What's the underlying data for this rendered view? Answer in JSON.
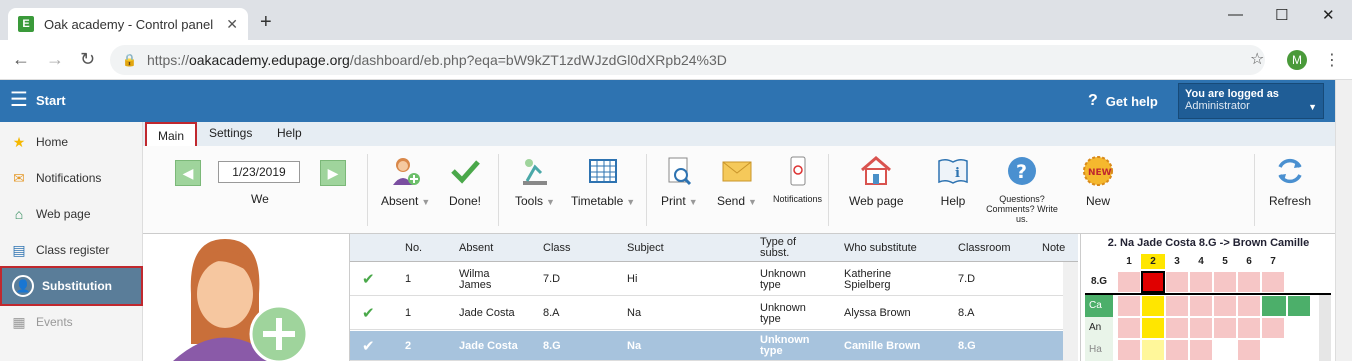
{
  "browser": {
    "tab_title": "Oak academy - Control panel",
    "favicon_letter": "E",
    "url_host": "oakacademy.edupage.org",
    "url_path": "/dashboard/eb.php?eqa=bW9kZT1zdWJzdGl0dXRpb24%3D",
    "url_scheme": "https://",
    "profile_initial": "M"
  },
  "header": {
    "start_label": "Start",
    "get_help": "Get help",
    "logged_line1": "You are logged as",
    "logged_line2": "Administrator"
  },
  "sidebar": {
    "items": [
      {
        "label": "Home",
        "icon": "star-icon"
      },
      {
        "label": "Notifications",
        "icon": "envelope-icon"
      },
      {
        "label": "Web page",
        "icon": "house-icon"
      },
      {
        "label": "Class register",
        "icon": "book-icon"
      },
      {
        "label": "Substitution",
        "icon": "person-icon"
      },
      {
        "label": "Events",
        "icon": "calendar-icon"
      }
    ]
  },
  "ribbon": {
    "tabs": [
      "Main",
      "Settings",
      "Help"
    ],
    "date": "1/23/2019",
    "weekday": "We",
    "buttons": {
      "absent": "Absent",
      "done": "Done!",
      "tools": "Tools",
      "timetable": "Timetable",
      "print": "Print",
      "send": "Send",
      "notifications": "Notifications",
      "webpage": "Web page",
      "help": "Help",
      "questions": "Questions? Comments? Write us.",
      "new": "New",
      "refresh": "Refresh"
    }
  },
  "table": {
    "headers": [
      "No.",
      "Absent",
      "Class",
      "Subject",
      "Type of subst.",
      "Who substitute",
      "Classroom",
      "Note"
    ],
    "rows": [
      {
        "no": "1",
        "absent": "Wilma James",
        "class": "7.D",
        "subject": "Hi",
        "type": "Unknown type",
        "who": "Katherine Spielberg",
        "room": "7.D",
        "note": ""
      },
      {
        "no": "1",
        "absent": "Jade Costa",
        "class": "8.A",
        "subject": "Na",
        "type": "Unknown type",
        "who": "Alyssa Brown",
        "room": "8.A",
        "note": ""
      },
      {
        "no": "2",
        "absent": "Jade Costa",
        "class": "8.G",
        "subject": "Na",
        "type": "Unknown type",
        "who": "Camille Brown",
        "room": "8.G",
        "note": ""
      }
    ]
  },
  "grid": {
    "title": "2. Na Jade Costa 8.G -> Brown Camille",
    "periods": [
      "1",
      "2",
      "3",
      "4",
      "5",
      "6",
      "7"
    ],
    "highlight_period": "2",
    "rows": [
      "8.G",
      "Ca",
      "An",
      "Ha"
    ]
  }
}
